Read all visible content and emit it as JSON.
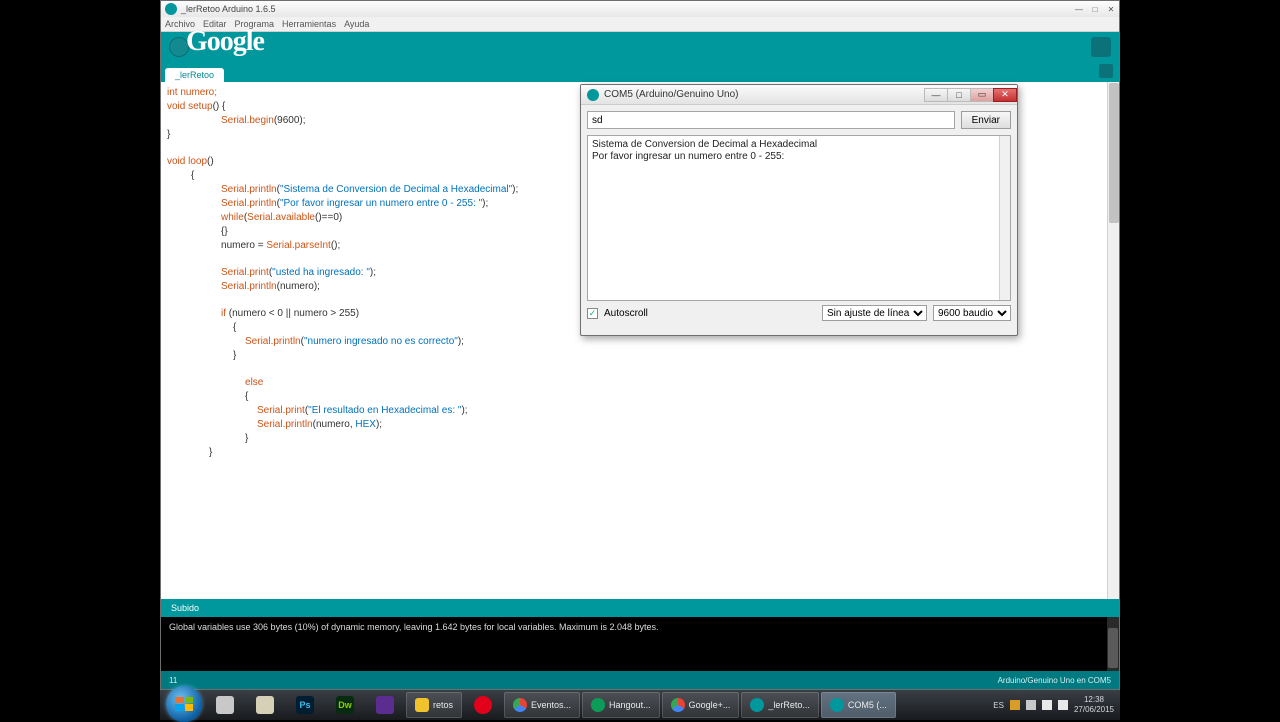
{
  "ide": {
    "title": "_lerRetoo Arduino 1.6.5",
    "menus": [
      "Archivo",
      "Editar",
      "Programa",
      "Herramientas",
      "Ayuda"
    ],
    "tab": "_lerRetoo",
    "logo": "Google",
    "status": "Subido",
    "console_line1": "",
    "console_line2": "Global variables use 306 bytes (10%) of dynamic memory, leaving 1.642 bytes for local variables. Maximum is 2.048 bytes.",
    "board": "Arduino/Genuino Uno en COM5",
    "line_col": "11"
  },
  "code": {
    "l1": "int numero;",
    "l2a": "void ",
    "l2b": "setup",
    "l2c": "() {",
    "l3a": "Serial",
    "l3b": ".begin",
    "l3c": "(9600);",
    "l4": "}",
    "l5a": "void ",
    "l5b": "loop",
    "l5c": "()",
    "l6": "{",
    "l7a": "Serial",
    "l7b": ".println",
    "l7c": "(",
    "l7d": "\"Sistema de Conversion de Decimal a Hexadecimal\"",
    "l7e": ");",
    "l8a": "Serial",
    "l8b": ".println",
    "l8c": "(",
    "l8d": "\"Por favor ingresar un numero entre 0 - 255: \"",
    "l8e": ");",
    "l9a": "while",
    "l9b": "(",
    "l9c": "Serial",
    "l9d": ".available",
    "l9e": "()==0)",
    "l10": "{}",
    "l11a": "numero = ",
    "l11b": "Serial",
    "l11c": ".parseInt",
    "l11d": "();",
    "l12a": "Serial",
    "l12b": ".print",
    "l12c": "(",
    "l12d": "\"usted ha ingresado: \"",
    "l12e": ");",
    "l13a": "Serial",
    "l13b": ".println",
    "l13c": "(numero);",
    "l14a": "if",
    "l14b": " (numero < 0 || numero > 255)",
    "l15": "{",
    "l16a": "Serial",
    "l16b": ".println",
    "l16c": "(",
    "l16d": "\"numero ingresado no es correcto\"",
    "l16e": ");",
    "l17": "}",
    "l18": "else",
    "l19": "{",
    "l20a": "Serial",
    "l20b": ".print",
    "l20c": "(",
    "l20d": "\"El resultado en Hexadecimal es: \"",
    "l20e": ");",
    "l21a": "Serial",
    "l21b": ".println",
    "l21c": "(numero, ",
    "l21d": "HEX",
    "l21e": ");",
    "l22": "}",
    "l23": "}"
  },
  "serial": {
    "title": "COM5 (Arduino/Genuino Uno)",
    "input_value": "sd",
    "send": "Enviar",
    "line1": "Sistema de Conversion de Decimal a Hexadecimal",
    "line2": "Por favor ingresar un numero entre 0 - 255:",
    "autoscroll": "Autoscroll",
    "lineending": "Sin ajuste de línea",
    "baud": "9600 baudio"
  },
  "taskbar": {
    "items": [
      {
        "label": "",
        "color": "#c8c8c8"
      },
      {
        "label": "",
        "color": "#d6d0b6"
      },
      {
        "label": "Ps",
        "color": "#001d31",
        "fg": "#39c0f0"
      },
      {
        "label": "Dw",
        "color": "#072b0f",
        "fg": "#8fce00"
      },
      {
        "label": "",
        "color": "#5c2d91"
      },
      {
        "label": "",
        "color": "#f0c22b"
      }
    ],
    "tasks": [
      {
        "label": "retos",
        "icon": "#f0c22b"
      },
      {
        "label": "",
        "icon": "#e2001a"
      },
      {
        "label": "Eventos...",
        "icon": "#f2c44b"
      },
      {
        "label": "Hangout...",
        "icon": "#0b9d58"
      },
      {
        "label": "Google+...",
        "icon": "#f2c44b"
      },
      {
        "label": "_lerReto...",
        "icon": "#00979d"
      },
      {
        "label": "COM5 (...",
        "icon": "#00979d"
      }
    ],
    "lang": "ES",
    "time": "12:38",
    "date": "27/06/2015"
  }
}
